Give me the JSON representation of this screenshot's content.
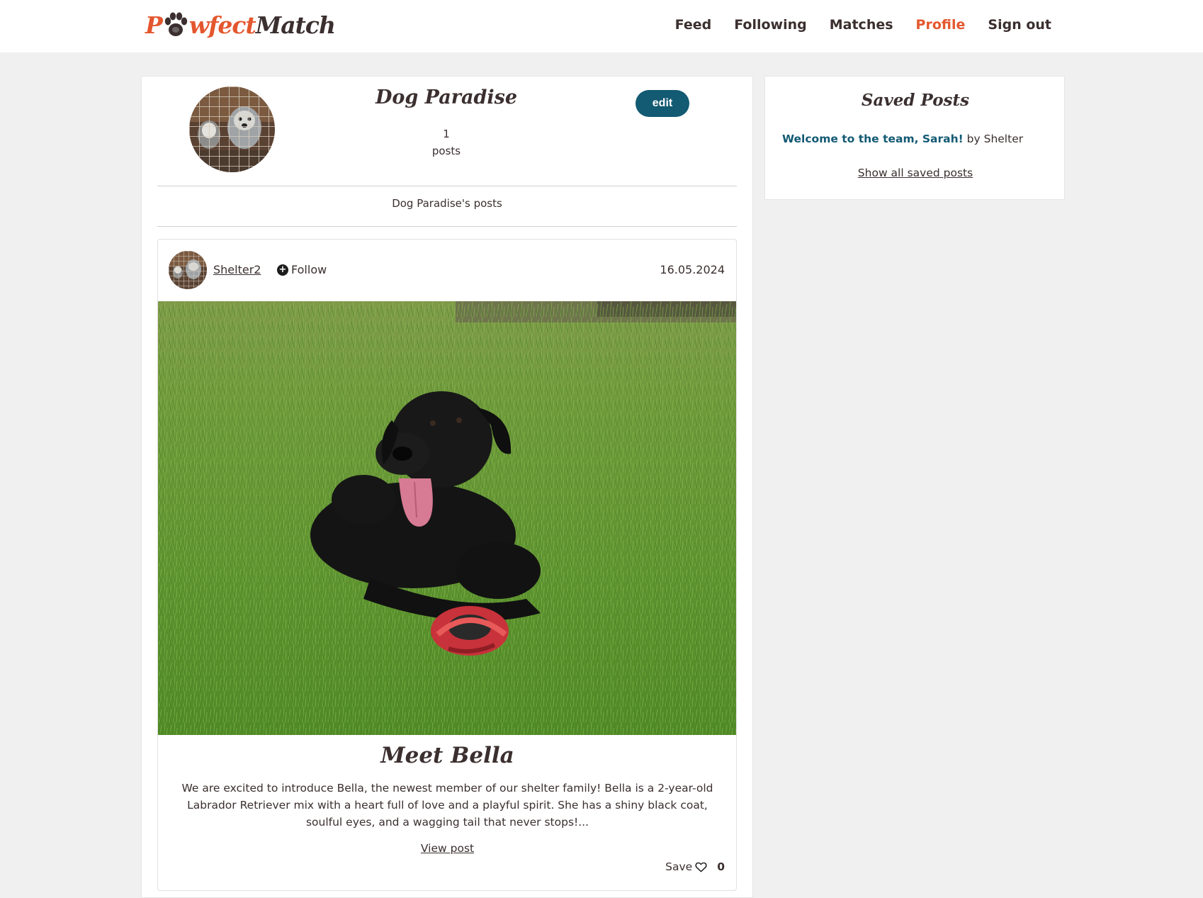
{
  "brand": {
    "logo_part1": "P",
    "logo_part2": "wfect",
    "logo_part3": "Match",
    "primary_color": "#e4572e",
    "accent_color": "#135a73"
  },
  "nav": {
    "items": [
      "Feed",
      "Following",
      "Matches",
      "Profile",
      "Sign out"
    ],
    "active": "Profile"
  },
  "profile": {
    "name": "Dog Paradise",
    "post_count": "1",
    "post_count_label": "posts",
    "edit_label": "edit",
    "posts_heading": "Dog Paradise's posts"
  },
  "post": {
    "author": "Shelter2",
    "follow_label": "Follow",
    "date": "16.05.2024",
    "title": "Meet Bella",
    "excerpt": "We are excited to introduce Bella, the newest member of our shelter family! Bella is a 2-year-old Labrador Retriever mix with a heart full of love and a playful spirit. She has a shiny black coat, soulful eyes, and a wagging tail that never stops!...",
    "view_label": "View post",
    "save_label": "Save",
    "save_count": "0"
  },
  "saved": {
    "title": "Saved Posts",
    "items": [
      {
        "title": "Welcome to the team, Sarah!",
        "by": "by Shelter"
      }
    ],
    "show_all_label": "Show all saved posts"
  },
  "icons": {
    "follow": "plus-circle-icon",
    "save": "heart-outline-icon",
    "logo_paw": "paw-icon"
  }
}
